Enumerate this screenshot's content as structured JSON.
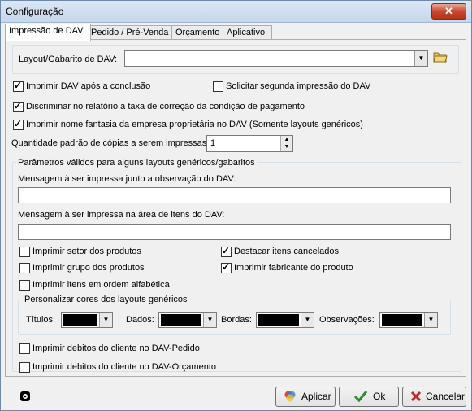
{
  "window": {
    "title": "Configuração",
    "close_glyph": "✕"
  },
  "tabs": [
    "Impressão de DAV",
    "Pedido / Pré-Venda",
    "Orçamento",
    "Aplicativo"
  ],
  "layout": {
    "label": "Layout/Gabarito de DAV:",
    "value": "",
    "folder_icon": "folder-open-icon"
  },
  "options": {
    "imprimir_apos": {
      "label": "Imprimir DAV após a conclusão",
      "checked": true
    },
    "segunda_impressao": {
      "label": "Solicitar segunda impressão do DAV",
      "checked": false
    },
    "discriminar_taxa": {
      "label": "Discriminar no relatório a taxa de correção da condição de pagamento",
      "checked": true
    },
    "nome_fantasia": {
      "label": "Imprimir nome fantasia da empresa proprietária no DAV (Somente layouts genéricos)",
      "checked": true
    }
  },
  "copias": {
    "label": "Quantidade padrão de cópias a serem impressas:",
    "value": "1"
  },
  "parametros": {
    "title": "Parâmetros válidos para alguns layouts genéricos/gabaritos",
    "msg_observacao_label": "Mensagem à ser impressa junto a observação do DAV:",
    "msg_observacao_value": "",
    "msg_itens_label": "Mensagem à ser impressa na área de itens do DAV:",
    "msg_itens_value": "",
    "setor": {
      "label": "Imprimir setor dos produtos",
      "checked": false
    },
    "destacar": {
      "label": "Destacar itens cancelados",
      "checked": true
    },
    "grupo": {
      "label": "Imprimir grupo dos produtos",
      "checked": false
    },
    "fabricante": {
      "label": "Imprimir fabricante do produto",
      "checked": true
    },
    "alfabetica": {
      "label": "Imprimir itens em ordem alfabética",
      "checked": false
    },
    "cores": {
      "title": "Personalizar cores dos layouts genéricos",
      "titulos": "Títulos:",
      "dados": "Dados:",
      "bordas": "Bordas:",
      "observacoes": "Observações:",
      "color": "#000000"
    }
  },
  "debitos_pedido": {
    "label": "Imprimir debitos do cliente no DAV-Pedido",
    "checked": false
  },
  "debitos_orcamento": {
    "label": "Imprimir debitos do cliente no DAV-Orçamento",
    "checked": false
  },
  "buttons": {
    "aplicar": "Aplicar",
    "ok": "Ok",
    "cancelar": "Cancelar"
  },
  "colors": {
    "ok_green": "#2e8b2e",
    "cancel_red": "#c0282a"
  }
}
